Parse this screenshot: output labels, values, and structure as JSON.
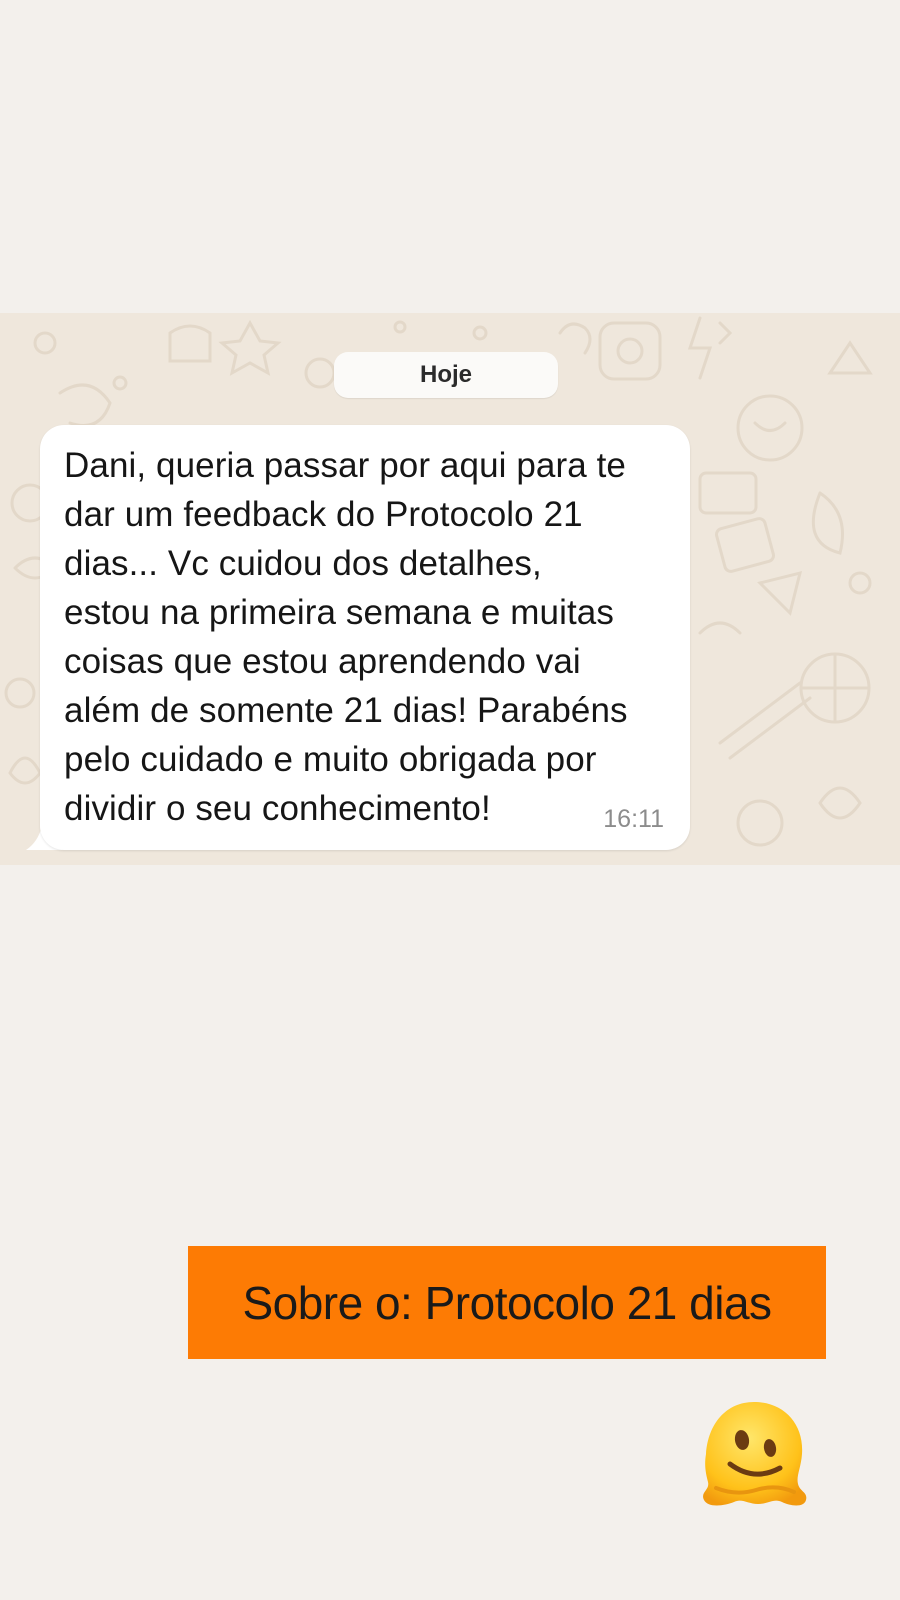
{
  "chat": {
    "date_label": "Hoje",
    "message": {
      "text": "Dani, queria passar por aqui para te\ndar um feedback do Protocolo 21\ndias... Vc cuidou dos detalhes,\nestou na primeira semana e muitas\ncoisas que estou aprendendo vai\nalém de somente 21 dias! Parabéns\npelo cuidado e muito obrigada por\ndividir o seu conhecimento!",
      "time": "16:11"
    },
    "background_color": "#efe7dc",
    "bubble_color": "#ffffff"
  },
  "caption": {
    "text": "Sobre o: Protocolo 21 dias",
    "color": "#fd7b04"
  },
  "sticker": {
    "icon": "melting-face-emoji-icon"
  },
  "page_background": "#f3f0ec"
}
